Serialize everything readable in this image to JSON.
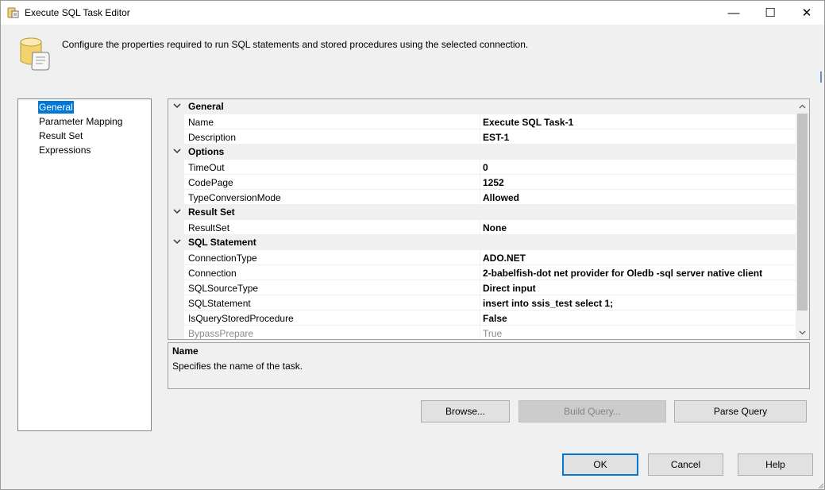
{
  "window": {
    "title": "Execute SQL Task Editor",
    "minimize_glyph": "—",
    "maximize_glyph": "☐",
    "close_glyph": "✕"
  },
  "header": {
    "description": "Configure the properties required to run SQL statements and stored procedures using the selected connection.",
    "icon": "database-scroll-icon"
  },
  "nav": {
    "items": [
      {
        "label": "General",
        "selected": true
      },
      {
        "label": "Parameter Mapping",
        "selected": false
      },
      {
        "label": "Result Set",
        "selected": false
      },
      {
        "label": "Expressions",
        "selected": false
      }
    ]
  },
  "grid": {
    "categories": {
      "general": {
        "label": "General"
      },
      "options": {
        "label": "Options"
      },
      "result_set": {
        "label": "Result Set"
      },
      "sql_statement": {
        "label": "SQL Statement"
      }
    },
    "props": {
      "name": {
        "name": "Name",
        "value": "Execute SQL Task-1"
      },
      "description": {
        "name": "Description",
        "value": "EST-1"
      },
      "timeout": {
        "name": "TimeOut",
        "value": "0"
      },
      "codepage": {
        "name": "CodePage",
        "value": "1252"
      },
      "type_conversion_mode": {
        "name": "TypeConversionMode",
        "value": "Allowed"
      },
      "resultset": {
        "name": "ResultSet",
        "value": "None"
      },
      "connection_type": {
        "name": "ConnectionType",
        "value": "ADO.NET"
      },
      "connection": {
        "name": "Connection",
        "value": "2-babelfish-dot net provider for Oledb -sql server native client"
      },
      "sql_source_type": {
        "name": "SQLSourceType",
        "value": "Direct input"
      },
      "sql_statement": {
        "name": "SQLStatement",
        "value": "insert into ssis_test select 1;"
      },
      "is_query_stored_procedure": {
        "name": "IsQueryStoredProcedure",
        "value": "False"
      },
      "bypass_prepare": {
        "name": "BypassPrepare",
        "value": "True",
        "disabled": true
      }
    }
  },
  "description_panel": {
    "title": "Name",
    "text": "Specifies the name of the task."
  },
  "buttons": {
    "browse": "Browse...",
    "build_query": "Build Query...",
    "parse_query": "Parse Query",
    "ok": "OK",
    "cancel": "Cancel",
    "help": "Help"
  },
  "colors": {
    "selection": "#0078d7",
    "category_bg": "#f0f0f0",
    "disabled_text": "#8a8a8a"
  }
}
